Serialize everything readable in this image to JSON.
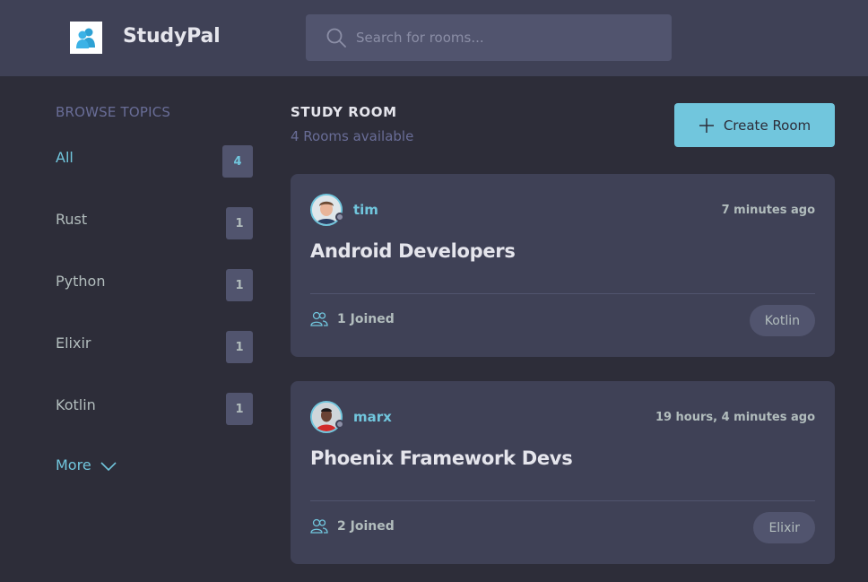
{
  "header": {
    "brand": "StudyPal",
    "search_placeholder": "Search for rooms..."
  },
  "sidebar": {
    "title": "BROWSE TOPICS",
    "topics": [
      {
        "label": "All",
        "count": "4",
        "active": true
      },
      {
        "label": "Rust",
        "count": "1"
      },
      {
        "label": "Python",
        "count": "1"
      },
      {
        "label": "Elixir",
        "count": "1"
      },
      {
        "label": "Kotlin",
        "count": "1"
      }
    ],
    "more_label": "More"
  },
  "main": {
    "heading": "STUDY ROOM",
    "rooms_available": "4 Rooms available",
    "create_label": "Create Room",
    "rooms": [
      {
        "user": "tim",
        "time": "7 minutes ago",
        "title": "Android Developers",
        "joined": "1 Joined",
        "tag": "Kotlin"
      },
      {
        "user": "marx",
        "time": "19 hours, 4 minutes ago",
        "title": "Phoenix Framework Devs",
        "joined": "2 Joined",
        "tag": "Elixir"
      }
    ]
  },
  "colors": {
    "background": "#2d2d39",
    "header": "#3f4156",
    "card": "#3f4156",
    "accent": "#71c6dd",
    "muted": "#696d97"
  },
  "icons": [
    "users-logo-icon",
    "search-icon",
    "chevron-down-icon",
    "plus-icon",
    "people-icon"
  ]
}
